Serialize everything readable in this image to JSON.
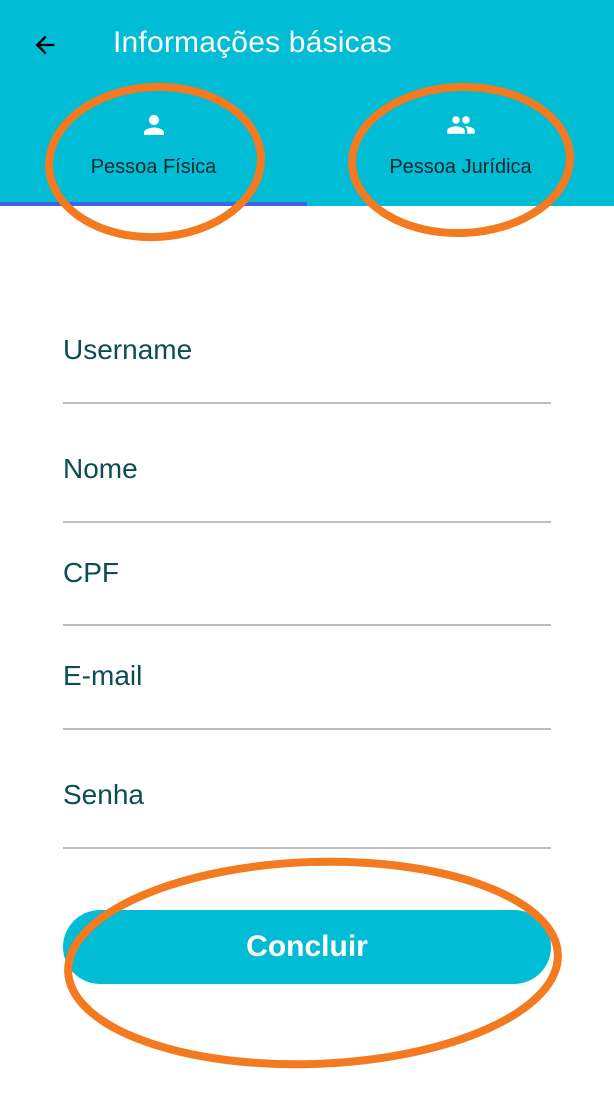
{
  "header": {
    "title": "Informações básicas",
    "back_icon": "arrow-left-icon"
  },
  "tabs": [
    {
      "label": "Pessoa Física",
      "icon": "person-icon",
      "selected": true
    },
    {
      "label": "Pessoa Jurídica",
      "icon": "people-icon",
      "selected": false
    }
  ],
  "form": {
    "fields": [
      {
        "label": "Username",
        "value": ""
      },
      {
        "label": "Nome",
        "value": ""
      },
      {
        "label": "CPF",
        "value": ""
      },
      {
        "label": "E-mail",
        "value": ""
      },
      {
        "label": "Senha",
        "value": ""
      }
    ],
    "submit_label": "Concluir"
  },
  "colors": {
    "primary": "#00bcd4",
    "tab_indicator": "#3f63e6",
    "field_label": "#0b4d52",
    "annotation": "#f47a20"
  }
}
